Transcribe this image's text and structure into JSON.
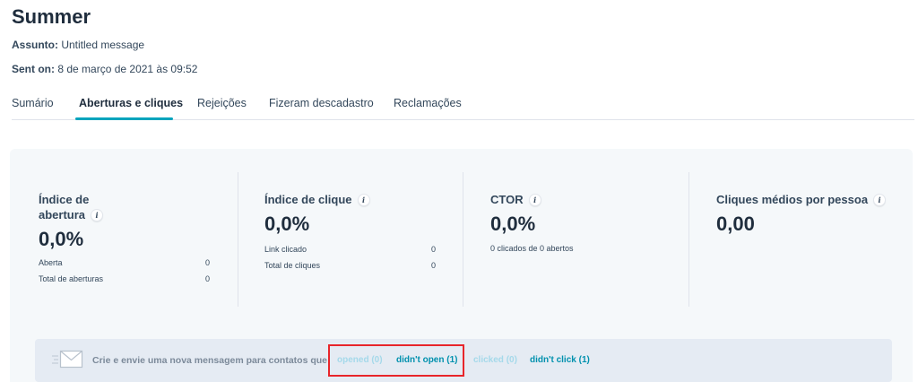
{
  "header": {
    "title": "Summer",
    "subject_label": "Assunto:",
    "subject_value": "Untitled message",
    "sent_label": "Sent on:",
    "sent_value": "8 de março de 2021 às 09:52"
  },
  "tabs": [
    {
      "label": "Sumário",
      "active": false
    },
    {
      "label": "Aberturas e cliques",
      "active": true
    },
    {
      "label": "Rejeições",
      "active": false
    },
    {
      "label": "Fizeram descadastro",
      "active": false
    },
    {
      "label": "Reclamações",
      "active": false
    }
  ],
  "metrics": {
    "open_rate": {
      "label_line1": "Índice de",
      "label_line2": "abertura",
      "value": "0,0%",
      "rows": [
        {
          "label": "Aberta",
          "value": "0"
        },
        {
          "label": "Total de aberturas",
          "value": "0"
        }
      ]
    },
    "click_rate": {
      "label": "Índice de clique",
      "value": "0,0%",
      "rows": [
        {
          "label": "Link clicado",
          "value": "0"
        },
        {
          "label": "Total de cliques",
          "value": "0"
        }
      ]
    },
    "ctor": {
      "label": "CTOR",
      "value": "0,0%",
      "sub": "0 clicados de 0 abertos"
    },
    "avg_clicks": {
      "label": "Cliques médios por pessoa",
      "value": "0,00"
    }
  },
  "banner": {
    "text": "Crie e envie uma nova mensagem para contatos que:",
    "links": [
      {
        "label": "opened (0)",
        "enabled": false
      },
      {
        "label": "didn't open (1)",
        "enabled": true
      },
      {
        "label": "clicked (0)",
        "enabled": false
      },
      {
        "label": "didn't click (1)",
        "enabled": true
      }
    ]
  },
  "icons": {
    "info": "info-icon",
    "mail": "envelope-icon"
  },
  "colors": {
    "accent": "#00a4bd",
    "link": "#0091ae",
    "link_disabled": "#a5d9ea",
    "highlight_box": "#e8252a",
    "panel_bg": "#f5f8fa",
    "banner_bg": "#e5ebf3"
  }
}
